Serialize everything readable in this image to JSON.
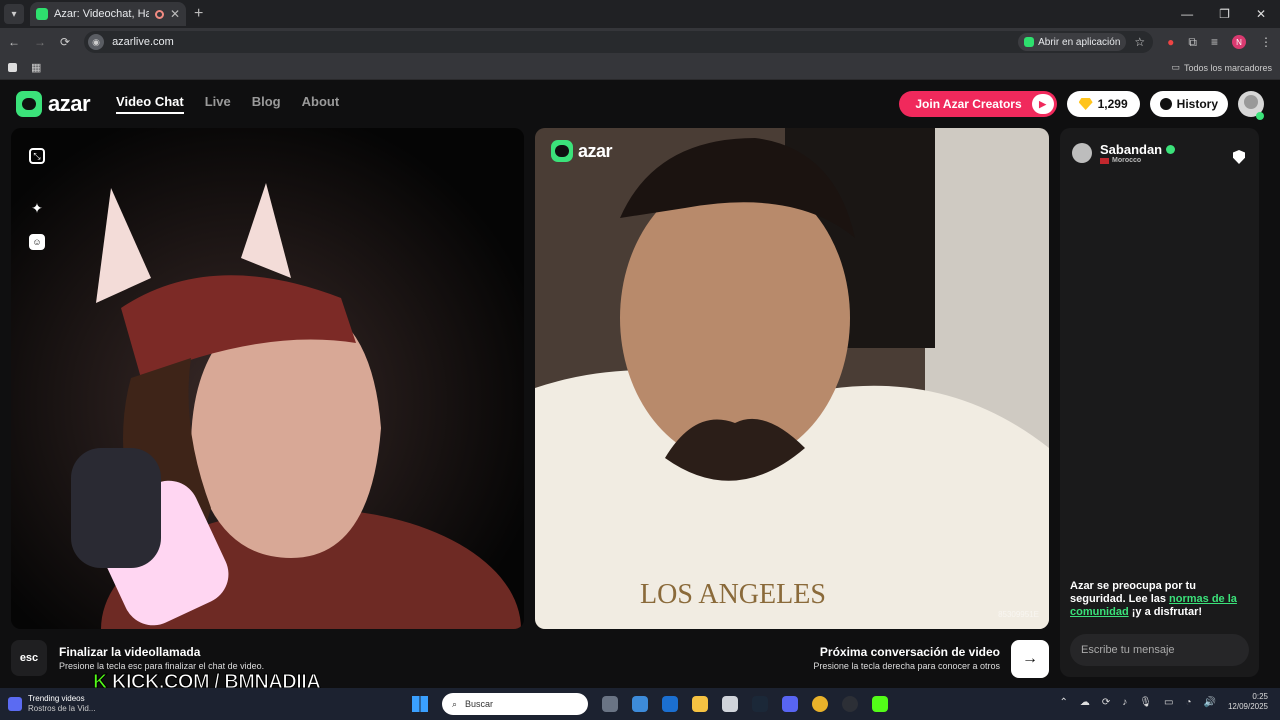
{
  "browser": {
    "tab_title": "Azar: Videochat, Haz nuevo",
    "url": "azarlive.com",
    "open_in_app": "Abrir en aplicación",
    "all_bookmarks": "Todos los marcadores",
    "profile_initial": "N"
  },
  "nav": {
    "brand": "azar",
    "links": [
      "Video Chat",
      "Live",
      "Blog",
      "About"
    ],
    "creators_label": "Join Azar Creators",
    "gems_count": "1,299",
    "history_label": "History"
  },
  "remote": {
    "watermark": "azar",
    "video_id": "85309951E"
  },
  "peer": {
    "name": "Sabandan",
    "country": "Morocco"
  },
  "chat": {
    "safety_prefix": "Azar se preocupa por tu seguridad. Lee las ",
    "safety_link": "normas de la comunidad",
    "safety_suffix": " ¡y a disfrutar!",
    "message_placeholder": "Escribe tu mensaje"
  },
  "controls": {
    "esc_key": "esc",
    "end_title": "Finalizar la videollamada",
    "end_sub": "Presione la tecla esc para finalizar el chat de video.",
    "next_title": "Próxima conversación de video",
    "next_sub": "Presione la tecla derecha para conocer a otros",
    "next_arrow": "→"
  },
  "overlay": {
    "kick_k": "K",
    "kick_text": " KICK.COM / BMNADIIA"
  },
  "taskbar": {
    "widget_title": "Trending videos",
    "widget_sub": "Rostros de la Vid...",
    "search_placeholder": "Buscar",
    "time": "0:25",
    "date": "12/09/2025"
  },
  "colors": {
    "accent": "#3be27a",
    "creators": "#f0295c",
    "gem": "#ffc41c"
  }
}
